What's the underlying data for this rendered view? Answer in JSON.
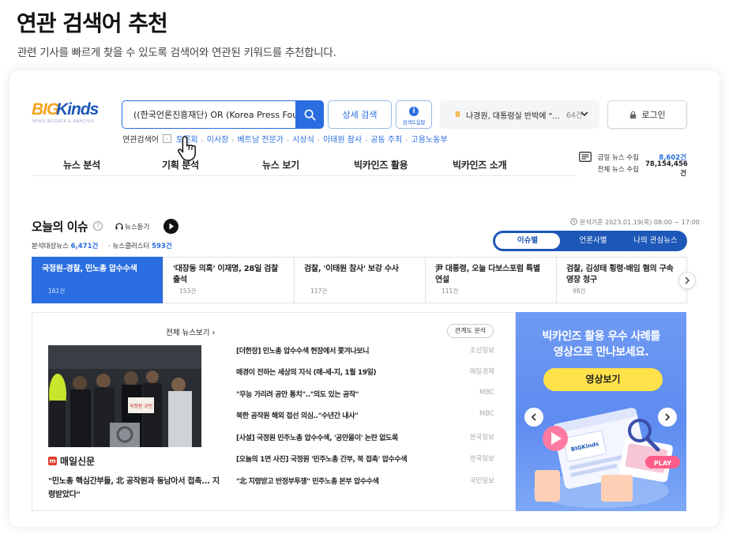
{
  "page": {
    "title": "연관 검색어 추천",
    "subtitle": "관련 기사를 빠르게 찾을 수 있도록 검색어와 연관된 키워드를 추천합니다."
  },
  "header": {
    "logo_big": "BIG",
    "logo_kinds": "Kinds",
    "logo_tagline": "NEWS BIGDATA & ANALYSIS",
    "search_value": "((한국언론진흥재단) OR (Korea Press Fou",
    "detail_search": "상세 검색",
    "help_label": "검색도움말",
    "trend_rank": "8",
    "trend_text": "나경원, 대통령실 반박에 \"...",
    "trend_count": "64건",
    "login": "로그인"
  },
  "related": {
    "label": "연관검색어",
    "keywords": [
      "토론회",
      "이사장",
      "베트남 전문가",
      "시상식",
      "이태원 참사",
      "공동 주최",
      "고용노동부"
    ]
  },
  "nav": {
    "items": [
      "뉴스 분석",
      "기획 분석",
      "뉴스 보기",
      "빅카인즈 활용",
      "빅카인즈 소개"
    ]
  },
  "stats": {
    "today_label": "금일 뉴스 수집",
    "today_value": "8,602건",
    "total_label": "전체 뉴스 수집",
    "total_value": "78,154,456건"
  },
  "issue": {
    "title": "오늘의 이슈",
    "listen": "뉴스듣기",
    "target_label": "분석대상뉴스",
    "target_value": "6,471건",
    "cluster_label": "뉴스클러스터",
    "cluster_value": "593건",
    "basis": "분석기준 2023.01.19(목) 08:00 ~ 17:00",
    "tabs": [
      "이슈별",
      "언론사별",
      "나의 관심뉴스"
    ],
    "cards": [
      {
        "title": "국정원-경찰, 민노총 압수수색",
        "count": "161건"
      },
      {
        "title": "'대장동 의혹' 이재명, 28일 검찰 출석",
        "count": "153건"
      },
      {
        "title": "검찰, '이태원 참사' 보강 수사",
        "count": "117건"
      },
      {
        "title": "尹 대통령, 오늘 다보스포럼 특별 연설",
        "count": "111건"
      },
      {
        "title": "검찰, 김성태 횡령·배임 혐의 구속영장 청구",
        "count": "98건"
      }
    ]
  },
  "news": {
    "all_link": "전체 뉴스보기 ›",
    "relation_map": "관계도 분석",
    "source": "매일신문",
    "headline": "\"민노총 핵심간부들, 北 공작원과 동남아서 접촉... 지령받았다\"",
    "photo_sign": "국정원 규탄",
    "list": [
      {
        "title": "[더한장] 민노총 압수수색 현장에서 쫓겨나보니",
        "publisher": "조선일보"
      },
      {
        "title": "매경이 전하는 세상의 지식 (매-세-지, 1월 19일)",
        "publisher": "매일경제"
      },
      {
        "title": "\"무능 가리려 공안 통치\"..\"의도 있는 공작\"",
        "publisher": "MBC"
      },
      {
        "title": "북한 공작원 해외 접선 의심..\"수년간 내사\"",
        "publisher": "MBC"
      },
      {
        "title": "[사설] 국정원 민주노총 압수수색, '공안몰이' 논란 없도록",
        "publisher": "한국일보"
      },
      {
        "title": "[오늘의 1면 사진] 국정원 '민주노총 간부, 북 접촉' 압수수색",
        "publisher": "한국일보"
      },
      {
        "title": "\"北 지령받고 반정부투쟁\" 민주노총 본부 압수수색",
        "publisher": "국민일보"
      }
    ]
  },
  "banner": {
    "line1": "빅카인즈 활용 우수 사례를",
    "line2": "영상으로 만나보세요.",
    "cta": "영상보기",
    "screen_logo": "BIGKinds",
    "play": "PLAY"
  }
}
